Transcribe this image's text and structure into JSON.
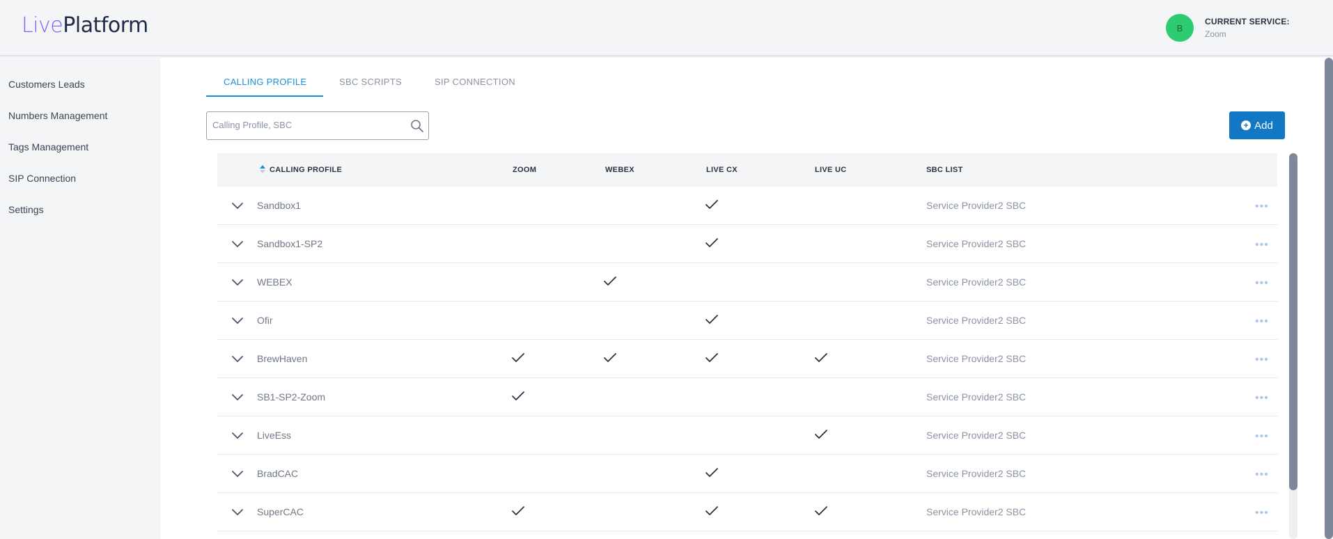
{
  "header": {
    "logo_live": "Live",
    "logo_platform": "Platform",
    "avatar_initial": "B",
    "service_label": "CURRENT SERVICE:",
    "service_value": "Zoom"
  },
  "sidebar": {
    "items": [
      {
        "label": "Customers Leads"
      },
      {
        "label": "Numbers Management"
      },
      {
        "label": "Tags Management"
      },
      {
        "label": "SIP Connection"
      },
      {
        "label": "Settings"
      }
    ]
  },
  "tabs": [
    {
      "label": "CALLING PROFILE",
      "active": true
    },
    {
      "label": "SBC SCRIPTS",
      "active": false
    },
    {
      "label": "SIP CONNECTION",
      "active": false
    }
  ],
  "search": {
    "placeholder": "Calling Profile, SBC"
  },
  "add_button": {
    "label": "Add"
  },
  "table": {
    "columns": [
      "CALLING PROFILE",
      "ZOOM",
      "WEBEX",
      "LIVE CX",
      "LIVE UC",
      "SBC LIST"
    ],
    "rows": [
      {
        "name": "Sandbox1",
        "zoom": false,
        "webex": false,
        "live_cx": true,
        "live_uc": false,
        "sbc": "Service Provider2 SBC"
      },
      {
        "name": "Sandbox1-SP2",
        "zoom": false,
        "webex": false,
        "live_cx": true,
        "live_uc": false,
        "sbc": "Service Provider2 SBC"
      },
      {
        "name": "WEBEX",
        "zoom": false,
        "webex": true,
        "live_cx": false,
        "live_uc": false,
        "sbc": "Service Provider2 SBC"
      },
      {
        "name": "Ofir",
        "zoom": false,
        "webex": false,
        "live_cx": true,
        "live_uc": false,
        "sbc": "Service Provider2 SBC"
      },
      {
        "name": "BrewHaven",
        "zoom": true,
        "webex": true,
        "live_cx": true,
        "live_uc": true,
        "sbc": "Service Provider2 SBC"
      },
      {
        "name": "SB1-SP2-Zoom",
        "zoom": true,
        "webex": false,
        "live_cx": false,
        "live_uc": false,
        "sbc": "Service Provider2 SBC"
      },
      {
        "name": "LiveEss",
        "zoom": false,
        "webex": false,
        "live_cx": false,
        "live_uc": true,
        "sbc": "Service Provider2 SBC"
      },
      {
        "name": "BradCAC",
        "zoom": false,
        "webex": false,
        "live_cx": true,
        "live_uc": false,
        "sbc": "Service Provider2 SBC"
      },
      {
        "name": "SuperCAC",
        "zoom": true,
        "webex": false,
        "live_cx": true,
        "live_uc": true,
        "sbc": "Service Provider2 SBC"
      }
    ],
    "row_actions_icon": "more-horizontal-icon",
    "check_icon": "check-icon",
    "expand_icon": "chevron-down-icon"
  },
  "colors": {
    "accent": "#1a8fd8",
    "button": "#1278c4",
    "avatar": "#2ecc71",
    "logo_accent": "#7b61ff"
  }
}
